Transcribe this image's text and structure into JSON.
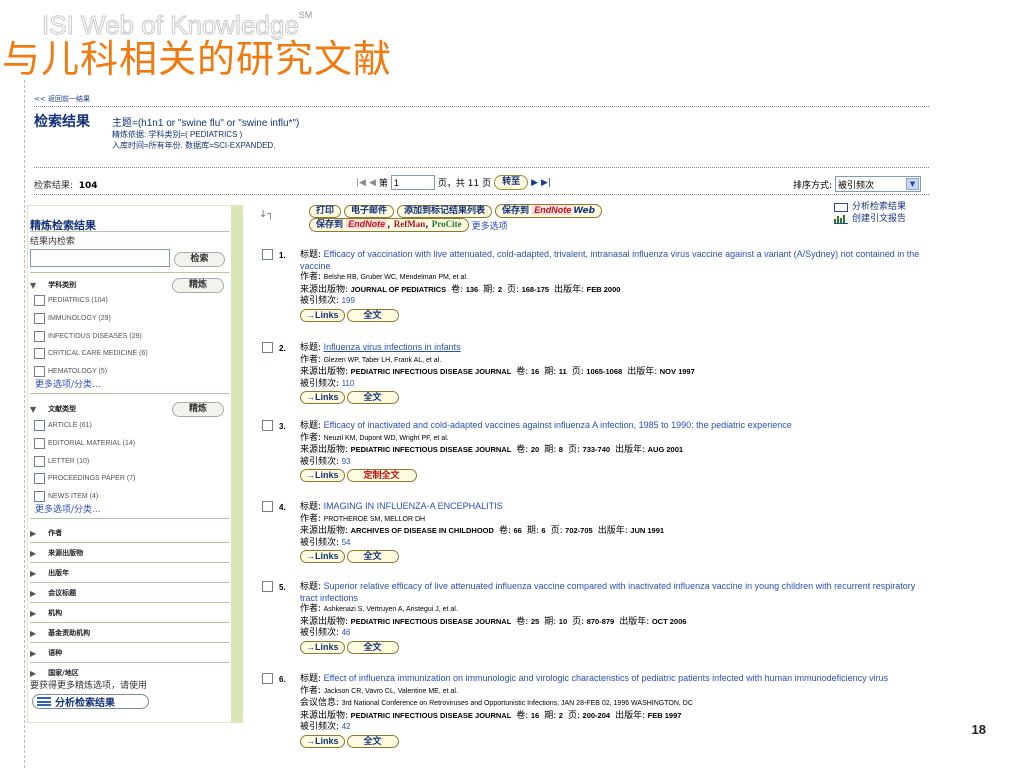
{
  "slide": {
    "watermark": "ISI Web of Knowledge",
    "watermark_sup": "SM",
    "title": "与儿科相关的研究文献",
    "page_number": "18"
  },
  "header": {
    "prev_link": "<< 返回前一结果",
    "results_title": "检索结果",
    "query_line": "主题=(h1n1 or \"swine flu\" or \"swine influ*\")",
    "refine_basis": "精炼依据: 学科类别=( PEDIATRICS )",
    "timespan": "入库时间=所有年份. 数据库=SCI-EXPANDED."
  },
  "summary": {
    "label": "检索结果:",
    "count": "104",
    "page_prefix": "第",
    "page_value": "1",
    "page_suffix": "页，共 11 页",
    "goto": "转至",
    "sort_label": "排序方式:",
    "sort_value": "被引频次"
  },
  "sidebar": {
    "title": "精炼检索结果",
    "subtitle": "结果内检索",
    "search_button": "检索",
    "refine_button": "精炼",
    "groups": {
      "category": "学科类别",
      "doctype": "文献类型",
      "author": "作者",
      "source": "来源出版物",
      "year": "出版年",
      "conference": "会议标题",
      "institution": "机构",
      "funding": "基金资助机构",
      "language": "语种",
      "country": "国家/地区"
    },
    "category_items": [
      "PEDIATRICS (104)",
      "IMMUNOLOGY (29)",
      "INFECTIOUS DISEASES (29)",
      "CRITICAL CARE MEDICINE (6)",
      "HEMATOLOGY (5)"
    ],
    "doctype_items": [
      "ARTICLE (61)",
      "EDITORIAL MATERIAL (14)",
      "LETTER (10)",
      "PROCEEDINGS PAPER (7)",
      "NEWS ITEM (4)"
    ],
    "more_options": "更多选项/分类...",
    "hint": "要获得更多精炼选项，请使用",
    "analyze_button": "分析检索结果"
  },
  "toolbar": {
    "print": "打印",
    "email": "电子邮件",
    "add_marked": "添加到标记结果列表",
    "save_to": "保存到",
    "endnote": "EndNote",
    "web": "Web",
    "save_to_2": "保存到",
    "endnote_2": "EndNote",
    "refman": "RefMan",
    "procite": "ProCite",
    "more_options": "更多选项",
    "analyze_results": "分析检索结果",
    "citation_report": "创建引文报告"
  },
  "labels": {
    "title": "标题:",
    "author": "作者:",
    "source": "来源出版物:",
    "volume": "卷:",
    "issue": "期:",
    "pages": "页:",
    "pubdate": "出版年:",
    "cited": "被引频次:",
    "conference": "会议信息:",
    "links": "→Links",
    "fulltext": "全文",
    "custom_fulltext": "定制全文"
  },
  "records": [
    {
      "num": "1.",
      "title": "Efficacy of vaccination with live attenuated, cold-adapted, trivalent, intranasal influenza virus vaccine against a variant (A/Sydney) not contained in the vaccine",
      "authors": "Belshe RB, Gruber WC, Mendelman PM, et al.",
      "journal": "JOURNAL OF PEDIATRICS",
      "volume": "136",
      "issue": "2",
      "pages": "168-175",
      "date": "FEB 2000",
      "cited": "199",
      "fulltext": "全文"
    },
    {
      "num": "2.",
      "title": "Influenza virus infections in infants",
      "authors": "Glezen WP, Taber LH, Frank AL, et al.",
      "journal": "PEDIATRIC INFECTIOUS DISEASE JOURNAL",
      "volume": "16",
      "issue": "11",
      "pages": "1065-1068",
      "date": "NOV 1997",
      "cited": "110",
      "fulltext": "全文"
    },
    {
      "num": "3.",
      "title": "Efficacy of inactivated and cold-adapted vaccines against influenza A infection, 1985 to 1990: the pediatric experience",
      "authors": "Neuzil KM, Dupont WD, Wright PF, et al.",
      "journal": "PEDIATRIC INFECTIOUS DISEASE JOURNAL",
      "volume": "20",
      "issue": "8",
      "pages": "733-740",
      "date": "AUG 2001",
      "cited": "93",
      "fulltext": "定制全文"
    },
    {
      "num": "4.",
      "title": "IMAGING IN INFLUENZA-A ENCEPHALITIS",
      "authors": "PROTHEROE SM, MELLOR DH",
      "journal": "ARCHIVES OF DISEASE IN CHILDHOOD",
      "volume": "66",
      "issue": "6",
      "pages": "702-705",
      "date": "JUN 1991",
      "cited": "54",
      "fulltext": "全文"
    },
    {
      "num": "5.",
      "title": "Superior relative efficacy of live attenuated influenza vaccine compared with inactivated influenza vaccine in young children with recurrent respiratory tract infections",
      "authors": "Ashkenazi S, Vertruyen A, Aristegui J, et al.",
      "journal": "PEDIATRIC INFECTIOUS DISEASE JOURNAL",
      "volume": "25",
      "issue": "10",
      "pages": "870-879",
      "date": "OCT 2006",
      "cited": "46",
      "fulltext": "全文"
    },
    {
      "num": "6.",
      "title": "Effect of influenza immunization on immunologic and virologic characteristics of pediatric patients infected with human immunodeficiency virus",
      "authors": "Jackson CR, Vavro CL, Valentine ME, et al.",
      "conference": "3rd National Conference on Retroviruses and Opportunistic Infections, JAN 28-FEB 02, 1996 WASHINGTON, DC",
      "journal": "PEDIATRIC INFECTIOUS DISEASE JOURNAL",
      "volume": "16",
      "issue": "2",
      "pages": "200-204",
      "date": "FEB 1997",
      "cited": "42",
      "fulltext": "全文"
    }
  ]
}
